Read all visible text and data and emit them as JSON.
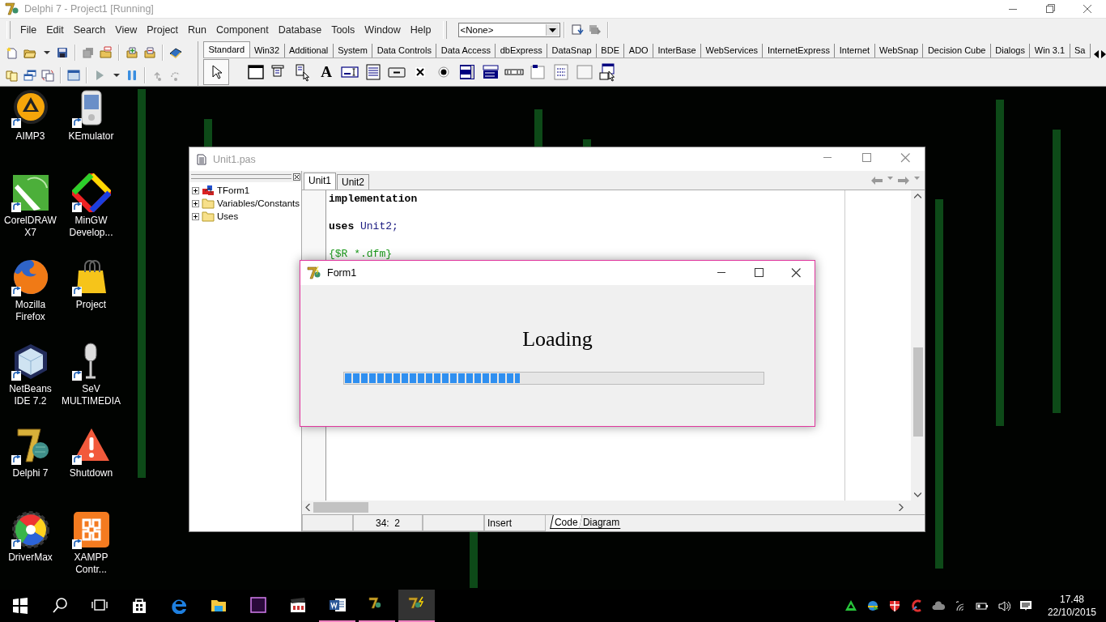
{
  "ide": {
    "title": "Delphi 7 - Project1 [Running]",
    "menu": [
      "File",
      "Edit",
      "Search",
      "View",
      "Project",
      "Run",
      "Component",
      "Database",
      "Tools",
      "Window",
      "Help"
    ],
    "component_combo": {
      "value": "<None>"
    },
    "palette_tabs": [
      {
        "label": "Standard",
        "selected": true
      },
      {
        "label": "Win32",
        "selected": false
      },
      {
        "label": "Additional",
        "selected": false
      },
      {
        "label": "System",
        "selected": false
      },
      {
        "label": "Data Controls",
        "selected": false
      },
      {
        "label": "Data Access",
        "selected": false
      },
      {
        "label": "dbExpress",
        "selected": false
      },
      {
        "label": "DataSnap",
        "selected": false
      },
      {
        "label": "BDE",
        "selected": false
      },
      {
        "label": "ADO",
        "selected": false
      },
      {
        "label": "InterBase",
        "selected": false
      },
      {
        "label": "WebServices",
        "selected": false
      },
      {
        "label": "InternetExpress",
        "selected": false
      },
      {
        "label": "Internet",
        "selected": false
      },
      {
        "label": "WebSnap",
        "selected": false
      },
      {
        "label": "Decision Cube",
        "selected": false
      },
      {
        "label": "Dialogs",
        "selected": false
      },
      {
        "label": "Win 3.1",
        "selected": false
      },
      {
        "label": "Sa",
        "selected": false
      }
    ],
    "label_tool_glyph": "A"
  },
  "desktop_icons": [
    {
      "label": "AIMP3",
      "kind": "aimp"
    },
    {
      "label": "KEmulator",
      "kind": "phone"
    },
    {
      "label": "CorelDRAW X7",
      "kind": "corel"
    },
    {
      "label": "MinGW Develop...",
      "kind": "diamond"
    },
    {
      "label": "Mozilla Firefox",
      "kind": "firefox"
    },
    {
      "label": "Project",
      "kind": "bag"
    },
    {
      "label": "NetBeans IDE 7.2",
      "kind": "cube"
    },
    {
      "label": "SeV MULTIMEDIA",
      "kind": "mic"
    },
    {
      "label": "Delphi 7",
      "kind": "delphi"
    },
    {
      "label": "Shutdown",
      "kind": "warning"
    },
    {
      "label": "DriverMax",
      "kind": "gear"
    },
    {
      "label": "XAMPP Contr...",
      "kind": "xampp"
    }
  ],
  "editor": {
    "title": "Unit1.pas",
    "tree": [
      {
        "label": "TForm1",
        "kind": "class"
      },
      {
        "label": "Variables/Constants",
        "kind": "folder"
      },
      {
        "label": "Uses",
        "kind": "folder"
      }
    ],
    "tabs": [
      {
        "label": "Unit1",
        "selected": true
      },
      {
        "label": "Unit2",
        "selected": false
      }
    ],
    "code_lines": [
      {
        "kind": "keyword",
        "text": "implementation"
      },
      {
        "kind": "blank"
      },
      {
        "kind": "code",
        "text": "**uses** Unit2;"
      },
      {
        "kind": "blank"
      },
      {
        "kind": "comment",
        "text": "{$R *.dfm}"
      }
    ],
    "status_bar": {
      "position": "34:  2",
      "mode": "Insert",
      "views": [
        {
          "label": "Code",
          "selected": true
        },
        {
          "label": "Diagram",
          "selected": false
        }
      ]
    }
  },
  "form": {
    "title": "Form1",
    "message": "Loading",
    "progress": {
      "level": 0.42
    }
  },
  "taskbar": {
    "apps": [
      {
        "kind": "start",
        "running": false,
        "selected": false
      },
      {
        "kind": "search",
        "running": false,
        "selected": false
      },
      {
        "kind": "task-view",
        "running": false,
        "selected": false
      },
      {
        "kind": "store",
        "running": false,
        "selected": false
      },
      {
        "kind": "edge",
        "running": false,
        "selected": false
      },
      {
        "kind": "explorer",
        "running": false,
        "selected": false
      },
      {
        "kind": "premiere",
        "running": false,
        "selected": false
      },
      {
        "kind": "media",
        "running": false,
        "selected": false
      },
      {
        "kind": "word",
        "running": true,
        "selected": false
      },
      {
        "kind": "delphi",
        "running": true,
        "selected": false
      },
      {
        "kind": "delphi-debug",
        "running": true,
        "selected": true
      }
    ],
    "clock": {
      "time": "17.48",
      "date": "22/10/2015"
    }
  }
}
